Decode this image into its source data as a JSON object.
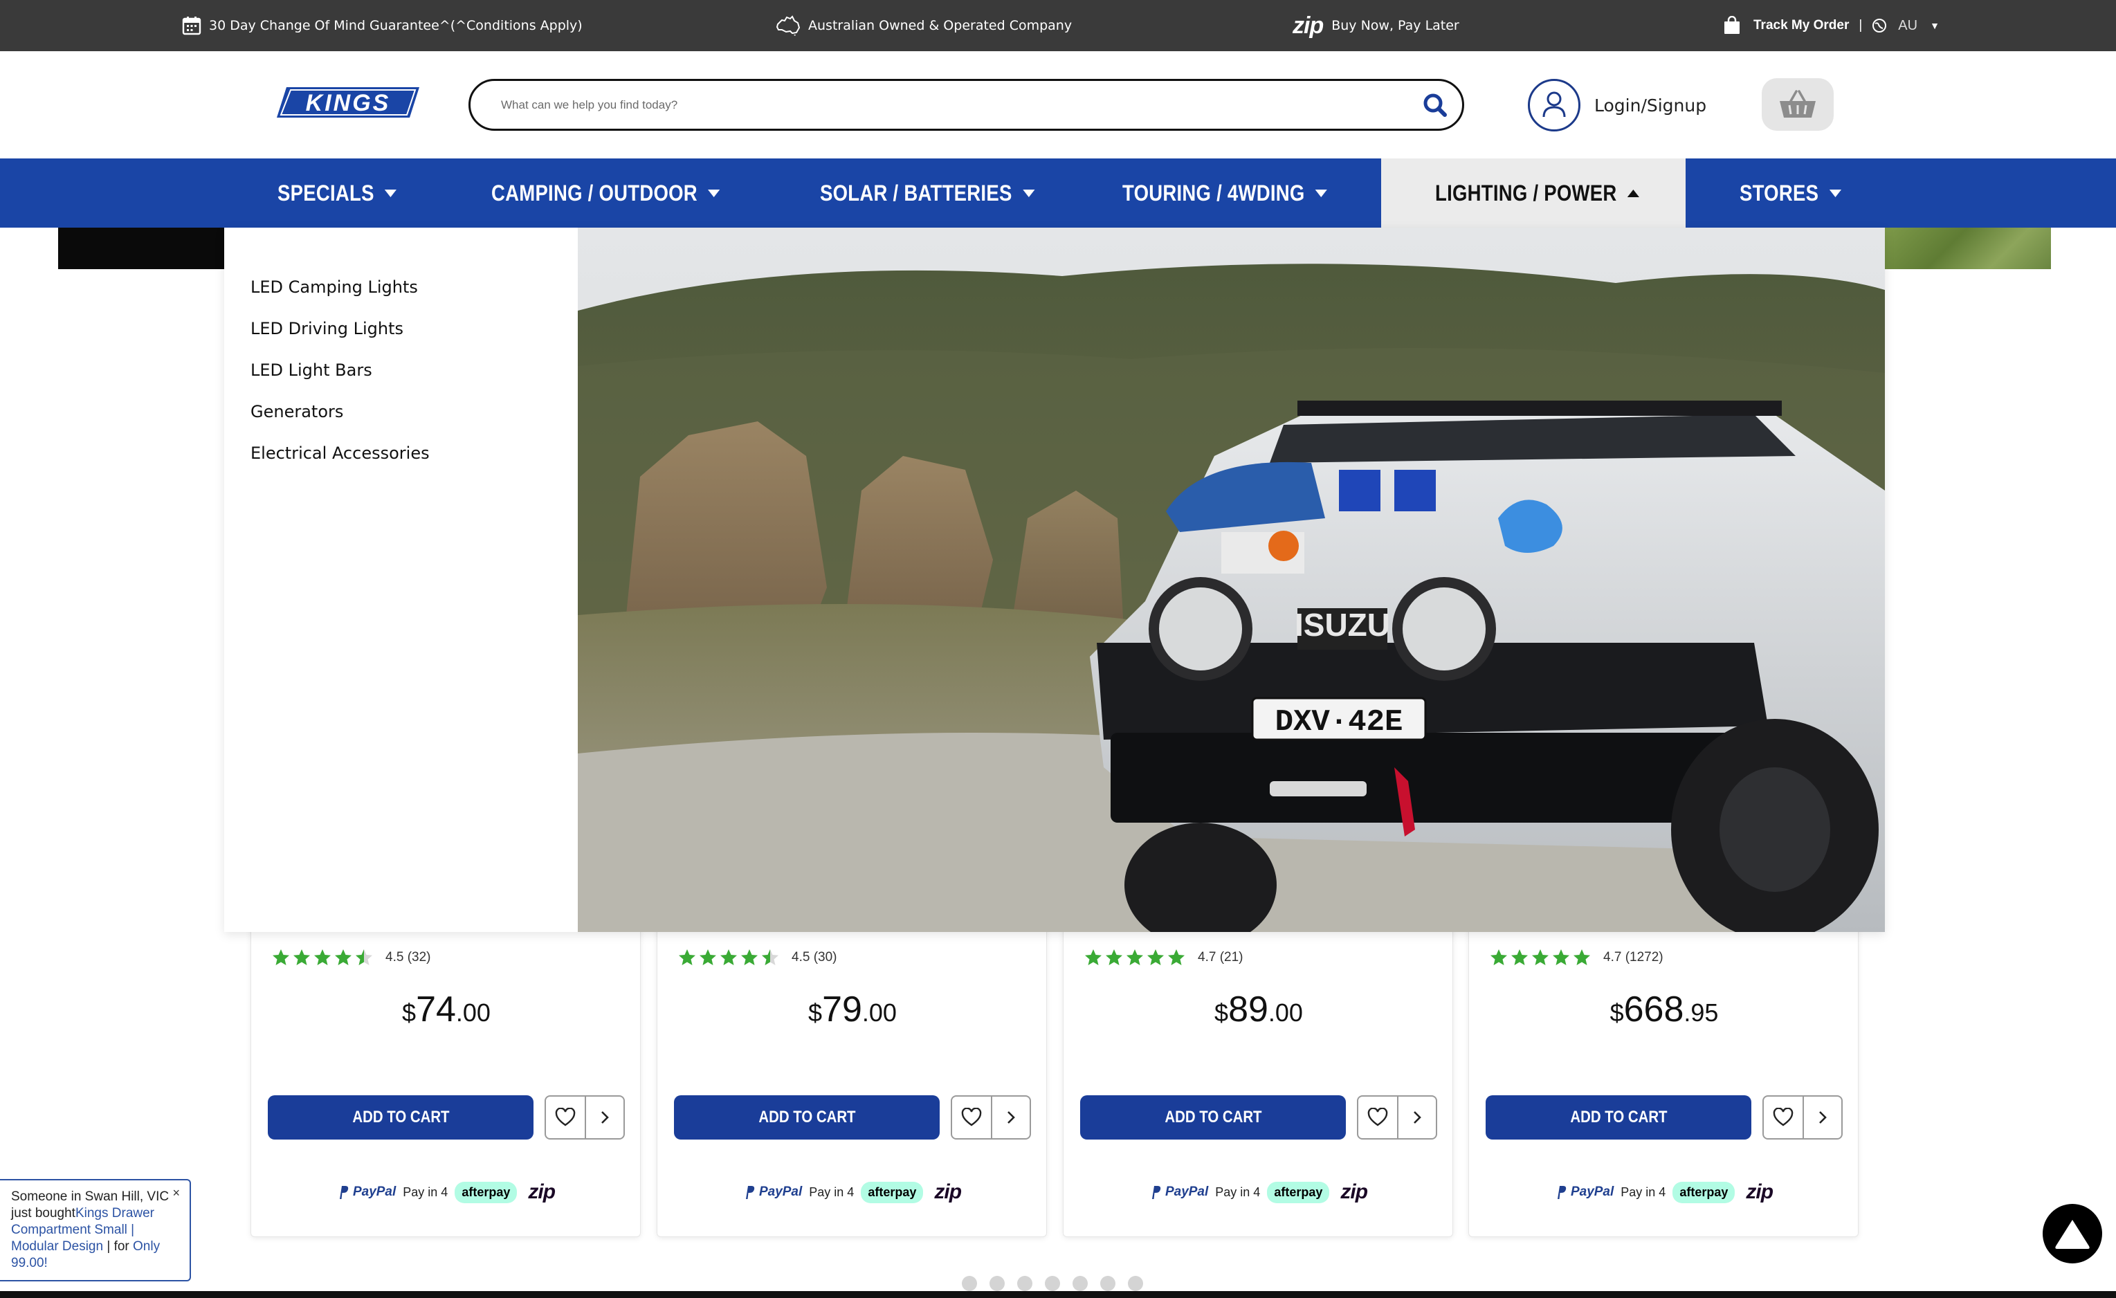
{
  "topbar": {
    "guarantee": "30 Day Change Of Mind Guarantee^(^Conditions Apply)",
    "australian": "Australian Owned & Operated Company",
    "zip_logo": "zip",
    "zip_text": "Buy Now, Pay Later",
    "track_order": "Track My Order",
    "separator": "|",
    "country": "AU"
  },
  "header": {
    "logo_text": "KINGS",
    "search_placeholder": "What can we help you find today?",
    "login_label": "Login/Signup"
  },
  "nav": {
    "items": [
      {
        "label": "SPECIALS"
      },
      {
        "label": "CAMPING / OUTDOOR"
      },
      {
        "label": "SOLAR / BATTERIES"
      },
      {
        "label": "TOURING / 4WDING"
      },
      {
        "label": "LIGHTING / POWER"
      },
      {
        "label": "STORES"
      }
    ]
  },
  "dropdown": {
    "items": [
      {
        "label": "LED Camping Lights"
      },
      {
        "label": "LED Driving Lights"
      },
      {
        "label": "LED Light Bars"
      },
      {
        "label": "Generators"
      },
      {
        "label": "Electrical Accessories"
      }
    ],
    "hero_plate": "DXV·42E",
    "hero_brand": "ISUZU"
  },
  "products": [
    {
      "rating": "4.5 (32)",
      "stars": 4.5,
      "currency": "$",
      "price_whole": "74",
      "price_cents": ".00",
      "add_to_cart": "ADD TO CART"
    },
    {
      "rating": "4.5 (30)",
      "stars": 4.5,
      "currency": "$",
      "price_whole": "79",
      "price_cents": ".00",
      "add_to_cart": "ADD TO CART"
    },
    {
      "rating": "4.7 (21)",
      "stars": 4.7,
      "currency": "$",
      "price_whole": "89",
      "price_cents": ".00",
      "add_to_cart": "ADD TO CART"
    },
    {
      "rating": "4.7 (1272)",
      "stars": 4.7,
      "currency": "$",
      "price_whole": "668",
      "price_cents": ".95",
      "add_to_cart": "ADD TO CART"
    }
  ],
  "payment": {
    "paypal": "PayPal",
    "pay_in_4": "Pay in 4",
    "afterpay": "afterpay",
    "zip": "zip"
  },
  "toast": {
    "prefix": "Someone in Swan Hill, VIC just bought",
    "product": "Kings Drawer Compartment Small | Modular Design",
    "mid": " | for ",
    "price": "Only 99.00!",
    "close": "×"
  },
  "carousel": {
    "dot_count": 7
  },
  "colors": {
    "nav_blue": "#1a45a6",
    "button_blue": "#1a3d99",
    "topbar": "#3a3a3a",
    "star_green": "#3aaa35",
    "afterpay_mint": "#b2fce4"
  }
}
